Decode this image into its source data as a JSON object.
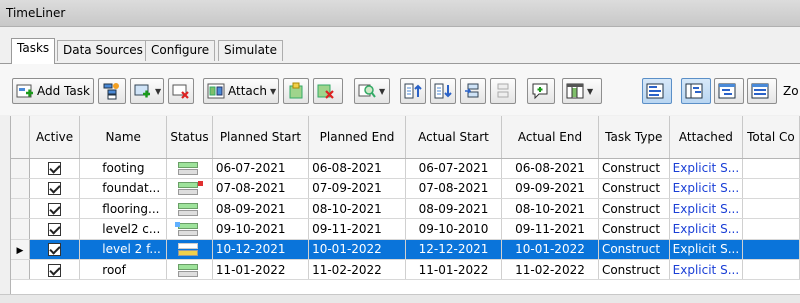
{
  "window": {
    "title": "TimeLiner"
  },
  "tabs": [
    "Tasks",
    "Data Sources",
    "Configure",
    "Simulate"
  ],
  "toolbar": {
    "add_task": "Add Task",
    "attach": "Attach",
    "zoom_label": "Zo"
  },
  "grid": {
    "columns": [
      "Active",
      "Name",
      "Status",
      "Planned Start",
      "Planned End",
      "Actual Start",
      "Actual End",
      "Task Type",
      "Attached",
      "Total Co"
    ],
    "rows": [
      {
        "name": "footing",
        "planned_start": "06-07-2021",
        "planned_end": "06-08-2021",
        "actual_start": "06-07-2021",
        "actual_end": "06-08-2021",
        "task_type": "Construct",
        "attached": "Explicit  S..."
      },
      {
        "name": "foundat...",
        "planned_start": "07-08-2021",
        "planned_end": "07-09-2021",
        "actual_start": "07-08-2021",
        "actual_end": "09-09-2021",
        "task_type": "Construct",
        "attached": "Explicit  S..."
      },
      {
        "name": "flooring...",
        "planned_start": "08-09-2021",
        "planned_end": "08-10-2021",
        "actual_start": "08-09-2021",
        "actual_end": "08-10-2021",
        "task_type": "Construct",
        "attached": "Explicit  S..."
      },
      {
        "name": "level2 c...",
        "planned_start": "09-10-2021",
        "planned_end": "09-11-2021",
        "actual_start": "09-10-2010",
        "actual_end": "09-11-2021",
        "task_type": "Construct",
        "attached": "Explicit  S..."
      },
      {
        "name": "level 2 f...",
        "planned_start": "10-12-2021",
        "planned_end": "10-01-2022",
        "actual_start": "12-12-2021",
        "actual_end": "10-01-2022",
        "task_type": "Construct",
        "attached": "Explicit  S..."
      },
      {
        "name": "roof",
        "planned_start": "11-01-2022",
        "planned_end": "11-02-2022",
        "actual_start": "11-01-2022",
        "actual_end": "11-02-2022",
        "task_type": "Construct",
        "attached": "Explicit  S..."
      }
    ],
    "selected_row": 4
  },
  "colors": {
    "selection": "#0a74da",
    "attached_link": "#1a3fd6"
  }
}
